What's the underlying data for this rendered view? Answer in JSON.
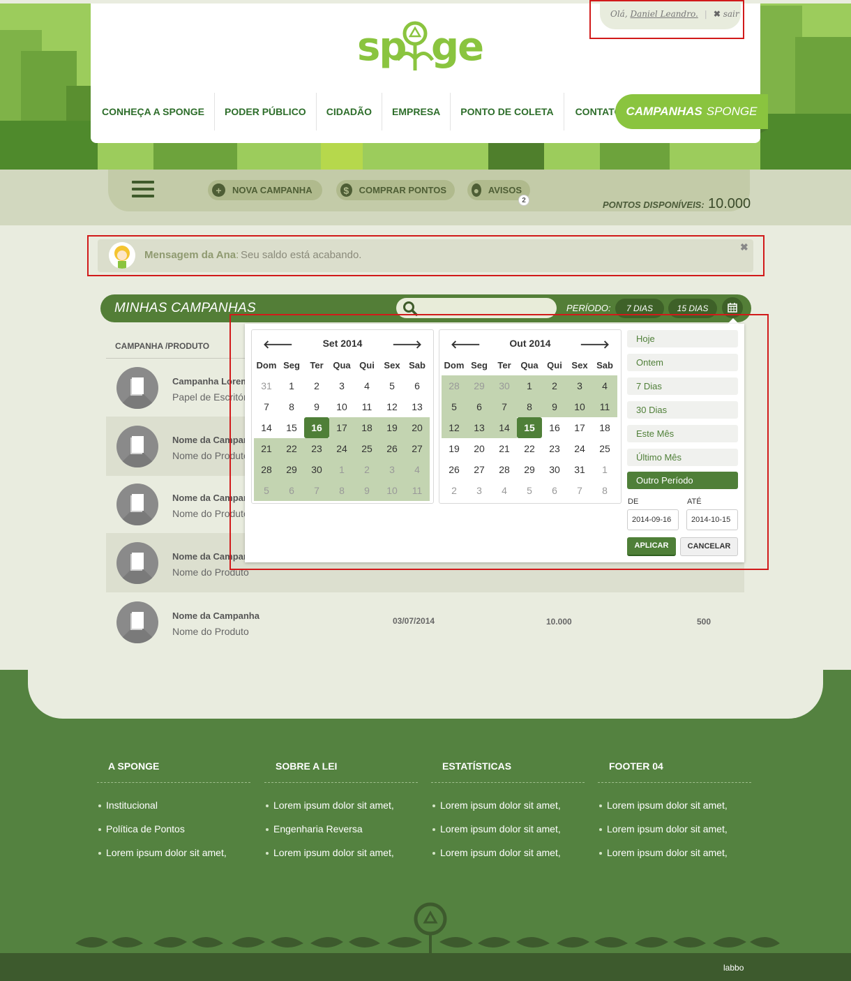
{
  "header": {
    "greeting": "Olá,",
    "user_name": "Daniel Leandro.",
    "sep": "|",
    "logout": "sair",
    "logo_text": "sponge",
    "nav": [
      "CONHEÇA A SPONGE",
      "PODER PÚBLICO",
      "CIDADÃO",
      "EMPRESA",
      "PONTO DE COLETA",
      "CONTATO"
    ],
    "campaigns_button": {
      "bold": "CAMPANHAS",
      "light": "SPONGE"
    }
  },
  "toolbar": {
    "new_campaign": "NOVA CAMPANHA",
    "buy_points": "COMPRAR PONTOS",
    "notices": "AVISOS",
    "notices_count": "2",
    "points_label": "PONTOS DISPONÍVEIS:",
    "points_value": "10.000"
  },
  "message": {
    "from": "Mensagem da Ana",
    "colon": ":",
    "text": "Seu saldo está acabando.",
    "close": "✖"
  },
  "campaigns": {
    "title": "MINHAS CAMPANHAS",
    "search_placeholder": "",
    "period_label": "PERÍODO:",
    "period_7": "7 DIAS",
    "period_15": "15 DIAS",
    "column_header": "CAMPANHA /PRODUTO",
    "rows": [
      {
        "name": "Campanha Lorem",
        "product": "Papel de Escritório",
        "date": "",
        "value1": "",
        "value2": ""
      },
      {
        "name": "Nome da Campanha",
        "product": "Nome do Produto",
        "date": "",
        "value1": "",
        "value2": ""
      },
      {
        "name": "Nome da Campanha",
        "product": "Nome do Produto",
        "date": "",
        "value1": "",
        "value2": ""
      },
      {
        "name": "Nome da Campanha",
        "product": "Nome do Produto",
        "date": "",
        "value1": "",
        "value2": ""
      },
      {
        "name": "Nome da Campanha",
        "product": "Nome do Produto",
        "date": "03/07/2014",
        "value1": "10.000",
        "value2": "500"
      }
    ]
  },
  "datepicker": {
    "weekdays": [
      "Dom",
      "Seg",
      "Ter",
      "Qua",
      "Qui",
      "Sex",
      "Sab"
    ],
    "left": {
      "title": "Set 2014",
      "weeks": [
        [
          "31",
          "1",
          "2",
          "3",
          "4",
          "5",
          "6"
        ],
        [
          "7",
          "8",
          "9",
          "10",
          "11",
          "12",
          "13"
        ],
        [
          "14",
          "15",
          "16",
          "17",
          "18",
          "19",
          "20"
        ],
        [
          "21",
          "22",
          "23",
          "24",
          "25",
          "26",
          "27"
        ],
        [
          "28",
          "29",
          "30",
          "1",
          "2",
          "3",
          "4"
        ],
        [
          "5",
          "6",
          "7",
          "8",
          "9",
          "10",
          "11"
        ]
      ]
    },
    "right": {
      "title": "Out 2014",
      "weeks": [
        [
          "28",
          "29",
          "30",
          "1",
          "2",
          "3",
          "4"
        ],
        [
          "5",
          "6",
          "7",
          "8",
          "9",
          "10",
          "11"
        ],
        [
          "12",
          "13",
          "14",
          "15",
          "16",
          "17",
          "18"
        ],
        [
          "19",
          "20",
          "21",
          "22",
          "23",
          "24",
          "25"
        ],
        [
          "26",
          "27",
          "28",
          "29",
          "30",
          "31",
          "1"
        ],
        [
          "2",
          "3",
          "4",
          "5",
          "6",
          "7",
          "8"
        ]
      ]
    },
    "ranges": [
      "Hoje",
      "Ontem",
      "7 Dias",
      "30 Dias",
      "Este Mês",
      "Último Mês",
      "Outro Período"
    ],
    "from_label": "DE",
    "to_label": "ATÉ",
    "from_value": "2014-09-16",
    "to_value": "2014-10-15",
    "apply": "APLICAR",
    "cancel": "CANCELAR"
  },
  "footer": {
    "columns": [
      {
        "title": "A SPONGE",
        "items": [
          "Institucional",
          "Política de Pontos",
          "Lorem ipsum dolor sit amet,"
        ]
      },
      {
        "title": "SOBRE A LEI",
        "items": [
          "Lorem ipsum dolor sit amet,",
          "Engenharia Reversa",
          "Lorem ipsum dolor sit amet,"
        ]
      },
      {
        "title": "ESTATÍSTICAS",
        "items": [
          "Lorem ipsum dolor sit amet,",
          "Lorem ipsum dolor sit amet,",
          "Lorem ipsum dolor sit amet,"
        ]
      },
      {
        "title": "FOOTER 04",
        "items": [
          "Lorem ipsum dolor sit amet,",
          "Lorem ipsum dolor sit amet,",
          "Lorem ipsum dolor sit amet,"
        ]
      }
    ],
    "credit": "labbo"
  },
  "colors": {
    "primary": "#548240",
    "accent": "#8ac43f",
    "dark": "#3d5a2d"
  }
}
